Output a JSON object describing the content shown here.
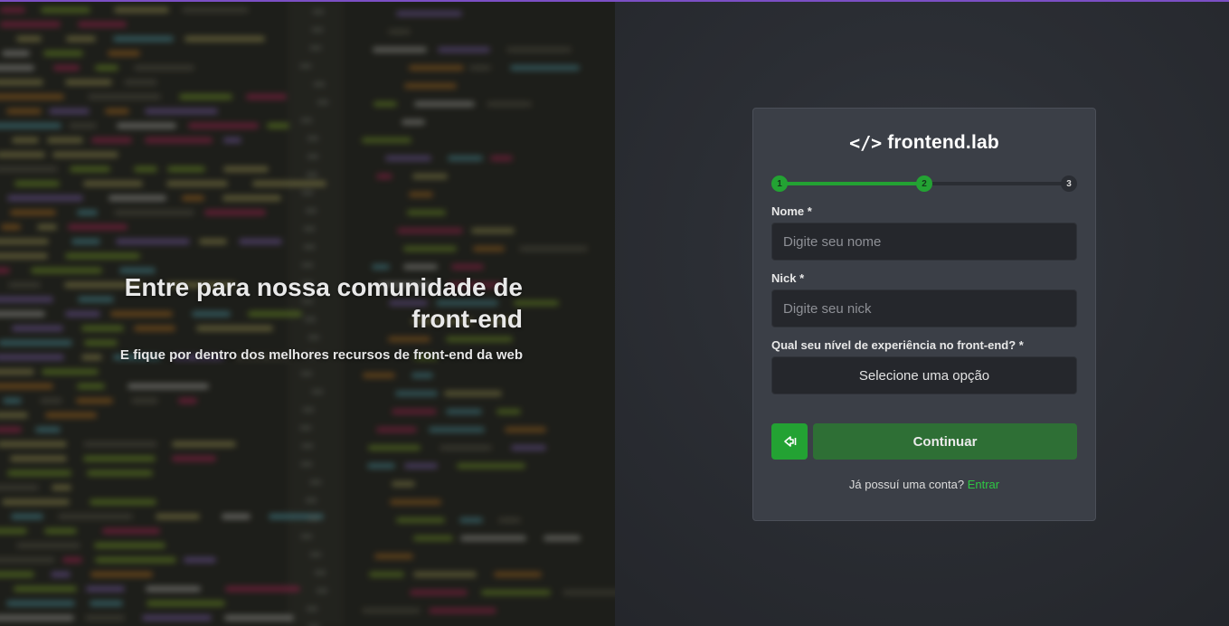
{
  "hero": {
    "title_line1": "Entre para nossa comunidade de",
    "title_line2": "front-end",
    "subtitle": "E fique por dentro dos melhores recursos de front-end da web"
  },
  "logo": {
    "mark": "</>",
    "text": "frontend.lab"
  },
  "stepper": {
    "steps": [
      "1",
      "2",
      "3"
    ],
    "current_step": 2,
    "progress": 0.5
  },
  "form": {
    "name_label": "Nome *",
    "name_placeholder": "Digite seu nome",
    "nick_label": "Nick *",
    "nick_placeholder": "Digite seu nick",
    "experience_label": "Qual seu nível de experiência no front-end? *",
    "experience_selected": "Selecione uma opção"
  },
  "actions": {
    "back_icon": "back-arrow-icon",
    "continue_label": "Continuar"
  },
  "footer": {
    "question": "Já possuí uma conta?",
    "link_label": "Entrar"
  },
  "colors": {
    "accent": "#23a233",
    "accent_dark": "#2e6f35",
    "link": "#2ec743",
    "card_bg": "#3b3f47",
    "input_bg": "#25272c",
    "top_line": "#7b4fc4"
  }
}
